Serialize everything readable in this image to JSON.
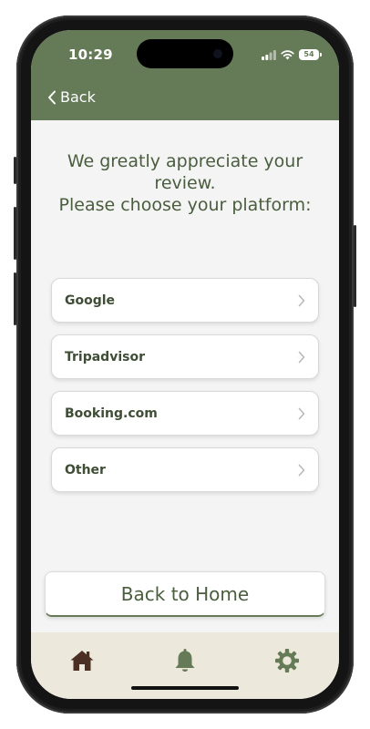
{
  "status_bar": {
    "time": "10:29",
    "battery": "54"
  },
  "nav": {
    "back_label": "Back"
  },
  "prompt": {
    "lines": [
      "We greatly appreciate your",
      "review.",
      "Please choose your platform:"
    ]
  },
  "platforms": [
    {
      "label": "Google"
    },
    {
      "label": "Tripadvisor"
    },
    {
      "label": "Booking.com"
    },
    {
      "label": "Other"
    }
  ],
  "home_button": {
    "label": "Back to Home"
  },
  "tab_bar": {
    "icons": [
      "home-icon",
      "bell-icon",
      "gear-icon"
    ]
  },
  "colors": {
    "header": "#657a56",
    "text_green": "#4a5d3e",
    "tab_bar": "#ede8dc",
    "home_icon": "#4a2f22"
  }
}
